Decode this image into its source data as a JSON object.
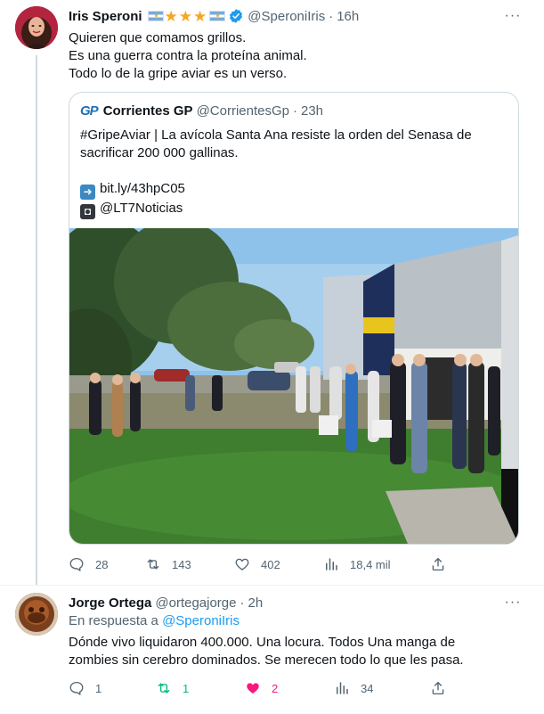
{
  "tweet1": {
    "author_name": "Iris Speroni",
    "handle": "@SperoniIris",
    "separator": "·",
    "time": "16h",
    "decorations": [
      "argentina-flag",
      "star",
      "star",
      "star",
      "argentina-flag",
      "verified-badge"
    ],
    "text_lines": [
      "Quieren que comamos grillos.",
      "Es una guerra contra la proteína animal.",
      "Todo lo de la gripe aviar es un verso."
    ],
    "quote": {
      "logo": "GP",
      "author_name": "Corrientes GP",
      "handle": "@CorrientesGp",
      "separator": "·",
      "time": "23h",
      "text_line1": "#GripeAviar | La avícola Santa Ana resiste la orden del Senasa de sacrificar 200 000 gallinas.",
      "link": "bit.ly/43hpC05",
      "credit": "@LT7Noticias",
      "link_icon": "right-arrow-emoji",
      "credit_icon": "camera-emoji",
      "photo_description_icon": "photo"
    },
    "actions": {
      "replies": "28",
      "retweets": "143",
      "likes": "402",
      "views": "18,4 mil"
    }
  },
  "tweet2": {
    "author_name": "Jorge Ortega",
    "handle": "@ortegajorge",
    "separator": "·",
    "time": "2h",
    "reply_prefix": "En respuesta a",
    "reply_handle": "@SperoniIris",
    "text": "Dónde vivo liquidaron 400.000. Una locura. Todos Una manga de zombies sin cerebro dominados. Se merecen todo lo que les pasa.",
    "actions": {
      "replies": "1",
      "retweets": "1",
      "likes": "2",
      "views": "34"
    }
  },
  "colors": {
    "text_primary": "#0f1419",
    "text_secondary": "#536471",
    "link_blue": "#1d9bf0",
    "retweet_green": "#00ba7c",
    "like_pink": "#f91880",
    "border": "#cfd9de"
  }
}
